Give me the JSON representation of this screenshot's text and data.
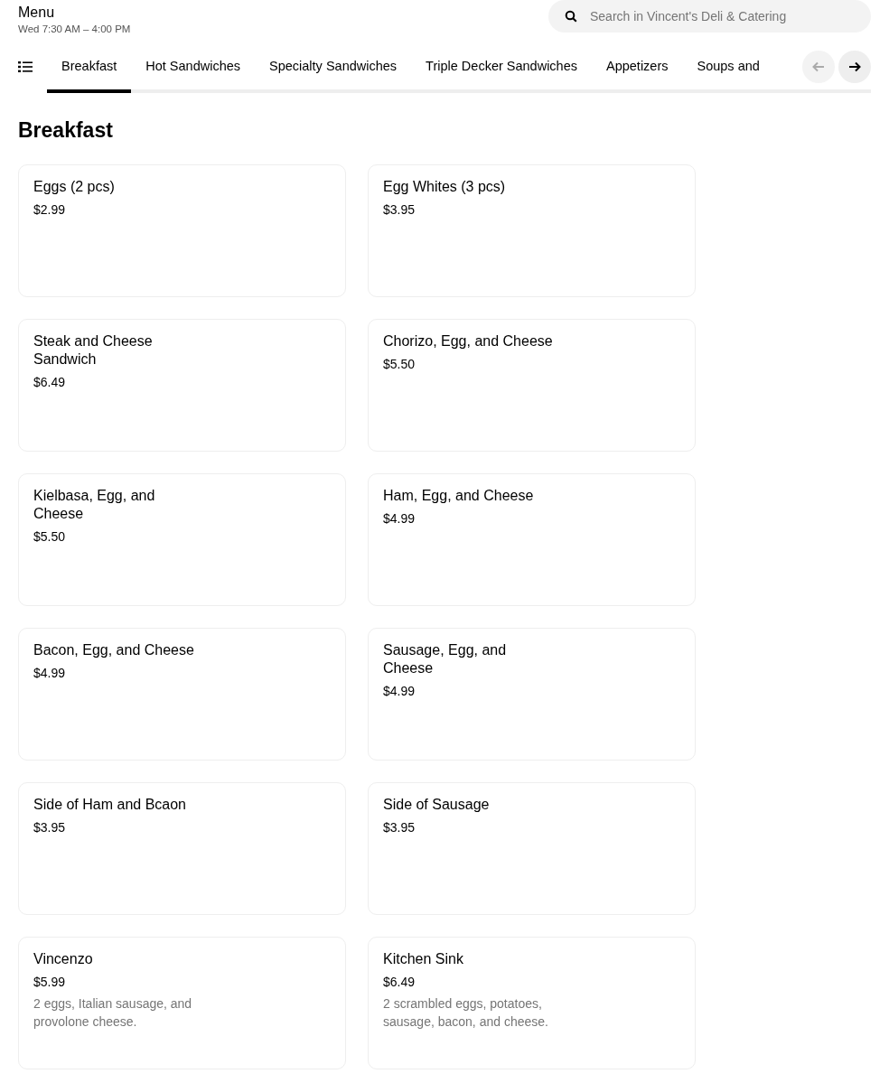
{
  "header": {
    "title": "Menu",
    "hours": "Wed 7:30 AM – 4:00 PM"
  },
  "search": {
    "placeholder": "Search in Vincent's Deli & Catering"
  },
  "tabs": [
    {
      "label": "Breakfast",
      "selected": true
    },
    {
      "label": "Hot Sandwiches",
      "selected": false
    },
    {
      "label": "Specialty Sandwiches",
      "selected": false
    },
    {
      "label": "Triple Decker Sandwiches",
      "selected": false
    },
    {
      "label": "Appetizers",
      "selected": false
    },
    {
      "label": "Soups and",
      "selected": false
    }
  ],
  "tab_nav": {
    "prev_disabled": true,
    "next_disabled": false
  },
  "section": {
    "title": "Breakfast"
  },
  "items": [
    {
      "name": "Eggs (2 pcs)",
      "price": "$2.99"
    },
    {
      "name": "Egg Whites (3 pcs)",
      "price": "$3.95"
    },
    {
      "name": "Steak and Cheese Sandwich",
      "price": "$6.49"
    },
    {
      "name": "Chorizo, Egg, and Cheese",
      "price": "$5.50"
    },
    {
      "name": "Kielbasa, Egg, and Cheese",
      "price": "$5.50"
    },
    {
      "name": "Ham, Egg, and Cheese",
      "price": "$4.99"
    },
    {
      "name": "Bacon, Egg, and Cheese",
      "price": "$4.99"
    },
    {
      "name": "Sausage, Egg, and Cheese",
      "price": "$4.99"
    },
    {
      "name": "Side of Ham and Bcaon",
      "price": "$3.95"
    },
    {
      "name": "Side of Sausage",
      "price": "$3.95"
    },
    {
      "name": "Vincenzo",
      "price": "$5.99",
      "description": "2 eggs, Italian sausage, and provolone cheese."
    },
    {
      "name": "Kitchen Sink",
      "price": "$6.49",
      "description": "2 scrambled eggs, potatoes, sausage, bacon, and cheese."
    }
  ]
}
